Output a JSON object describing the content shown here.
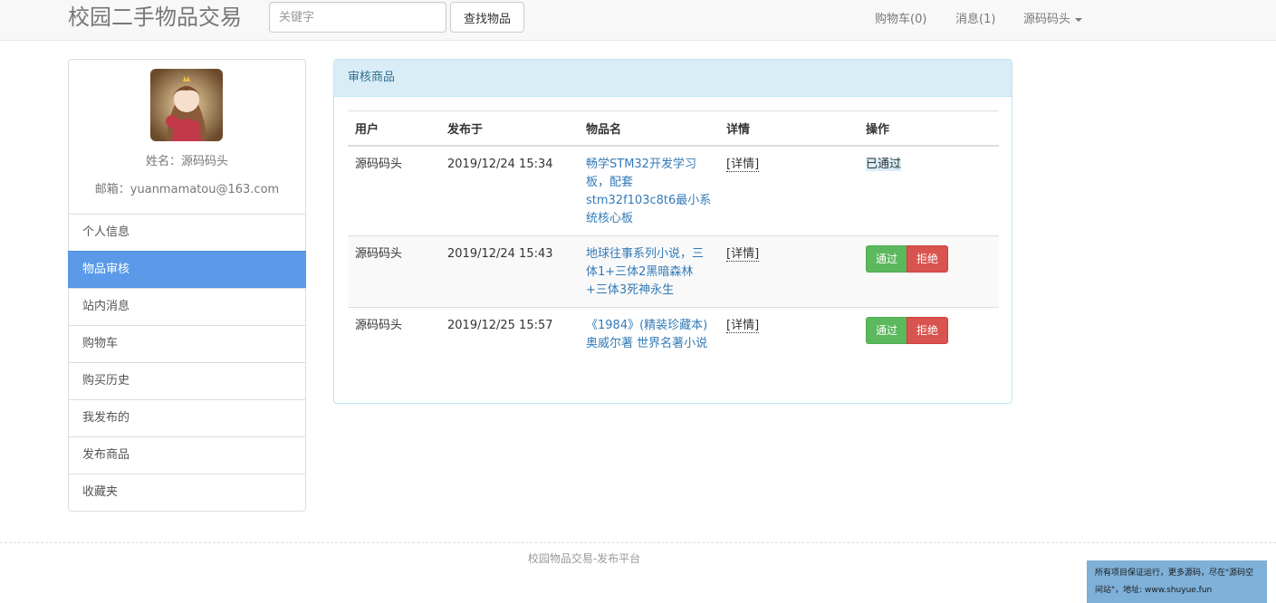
{
  "header": {
    "brand": "校园二手物品交易",
    "search_placeholder": "关键字",
    "search_button": "查找物品",
    "cart": "购物车(0)",
    "messages": "消息(1)",
    "user_menu": "源码码头"
  },
  "profile": {
    "name_line": "姓名：源码码头",
    "email_line": "邮箱：yuanmamatou@163.com"
  },
  "sidebar": {
    "items": [
      {
        "label": "个人信息"
      },
      {
        "label": "物品审核"
      },
      {
        "label": "站内消息"
      },
      {
        "label": "购物车"
      },
      {
        "label": "购买历史"
      },
      {
        "label": "我发布的"
      },
      {
        "label": "发布商品"
      },
      {
        "label": "收藏夹"
      }
    ]
  },
  "panel": {
    "title": "审核商品",
    "columns": [
      "用户",
      "发布于",
      "物品名",
      "详情",
      "操作"
    ],
    "rows": [
      {
        "user": "源码码头",
        "date": "2019/12/24 15:34",
        "item": "畅学STM32开发学习板，配套stm32f103c8t6最小系统核心板",
        "detail": "[详情]",
        "status": "已通过"
      },
      {
        "user": "源码码头",
        "date": "2019/12/24 15:43",
        "item": "地球往事系列小说，三体1+三体2黑暗森林+三体3死神永生",
        "detail": "[详情]",
        "pass": "通过",
        "reject": "拒绝"
      },
      {
        "user": "源码码头",
        "date": "2019/12/25 15:57",
        "item": "《1984》(精装珍藏本) 奥威尔著 世界名著小说",
        "detail": "[详情]",
        "pass": "通过",
        "reject": "拒绝"
      }
    ]
  },
  "footer": {
    "text": "校园物品交易-发布平台",
    "notice": "所有项目保证运行，更多源码，尽在\"源码空间站\"，地址: www.shuyue.fun"
  },
  "colors": {
    "active_menu": "#5a9ae8",
    "panel_heading": "#d9edf7",
    "pass_button": "#5cb85c",
    "reject_button": "#d9534f"
  }
}
